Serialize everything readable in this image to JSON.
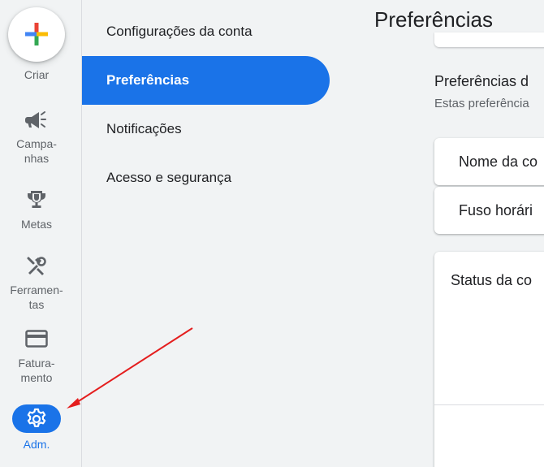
{
  "rail": {
    "create": "Criar",
    "items": [
      {
        "label": "Campa-\nnhas",
        "icon": "megaphone-icon"
      },
      {
        "label": "Metas",
        "icon": "trophy-icon"
      },
      {
        "label": "Ferramen-\ntas",
        "icon": "tools-icon"
      },
      {
        "label": "Fatura-\nmento",
        "icon": "credit-card-icon"
      },
      {
        "label": "Adm.",
        "icon": "gear-icon",
        "active": true
      }
    ]
  },
  "menu": {
    "items": [
      {
        "label": "Configurações da conta"
      },
      {
        "label": "Preferências",
        "selected": true
      },
      {
        "label": "Notificações"
      },
      {
        "label": "Acesso e segurança"
      }
    ]
  },
  "main": {
    "title": "Preferências",
    "section_title": "Preferências d",
    "section_subtitle": "Estas preferência",
    "rows": [
      {
        "label": "Nome da co"
      },
      {
        "label": "Fuso horári"
      }
    ],
    "status_title": "Status da co"
  },
  "colors": {
    "accent": "#1a73e8",
    "annotation": "#e41e1e",
    "background": "#f1f3f4"
  }
}
